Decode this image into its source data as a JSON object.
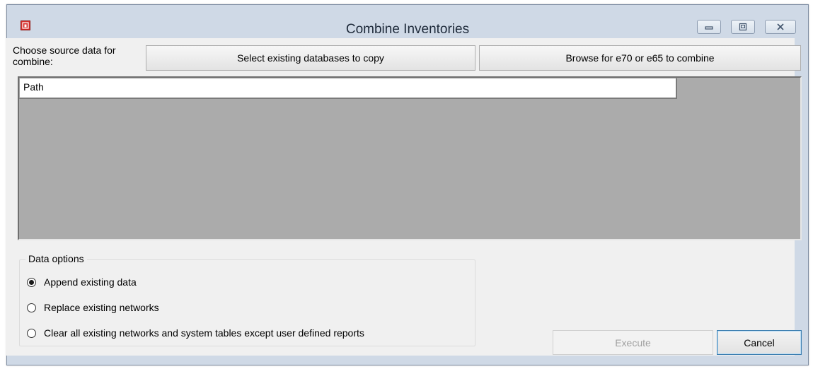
{
  "window": {
    "title": "Combine Inventories",
    "icon": "app-icon"
  },
  "caption_buttons": {
    "minimize": "minimize-icon",
    "maximize": "maximize-icon",
    "close": "close-icon"
  },
  "source": {
    "label": "Choose source data for combine:",
    "select_button": "Select existing databases to copy",
    "browse_button": "Browse for e70 or e65 to combine"
  },
  "grid": {
    "columns": [
      "Path"
    ],
    "rows": []
  },
  "data_options": {
    "legend": "Data options",
    "options": [
      {
        "label": "Append existing data",
        "checked": true
      },
      {
        "label": "Replace existing networks",
        "checked": false
      },
      {
        "label": "Clear all existing networks and system tables except user defined reports",
        "checked": false
      }
    ]
  },
  "actions": {
    "execute": "Execute",
    "execute_enabled": false,
    "cancel": "Cancel"
  },
  "colors": {
    "title_bar": "#cfd9e6",
    "grid_background": "#ababab",
    "cancel_border": "#3c7fb1"
  }
}
